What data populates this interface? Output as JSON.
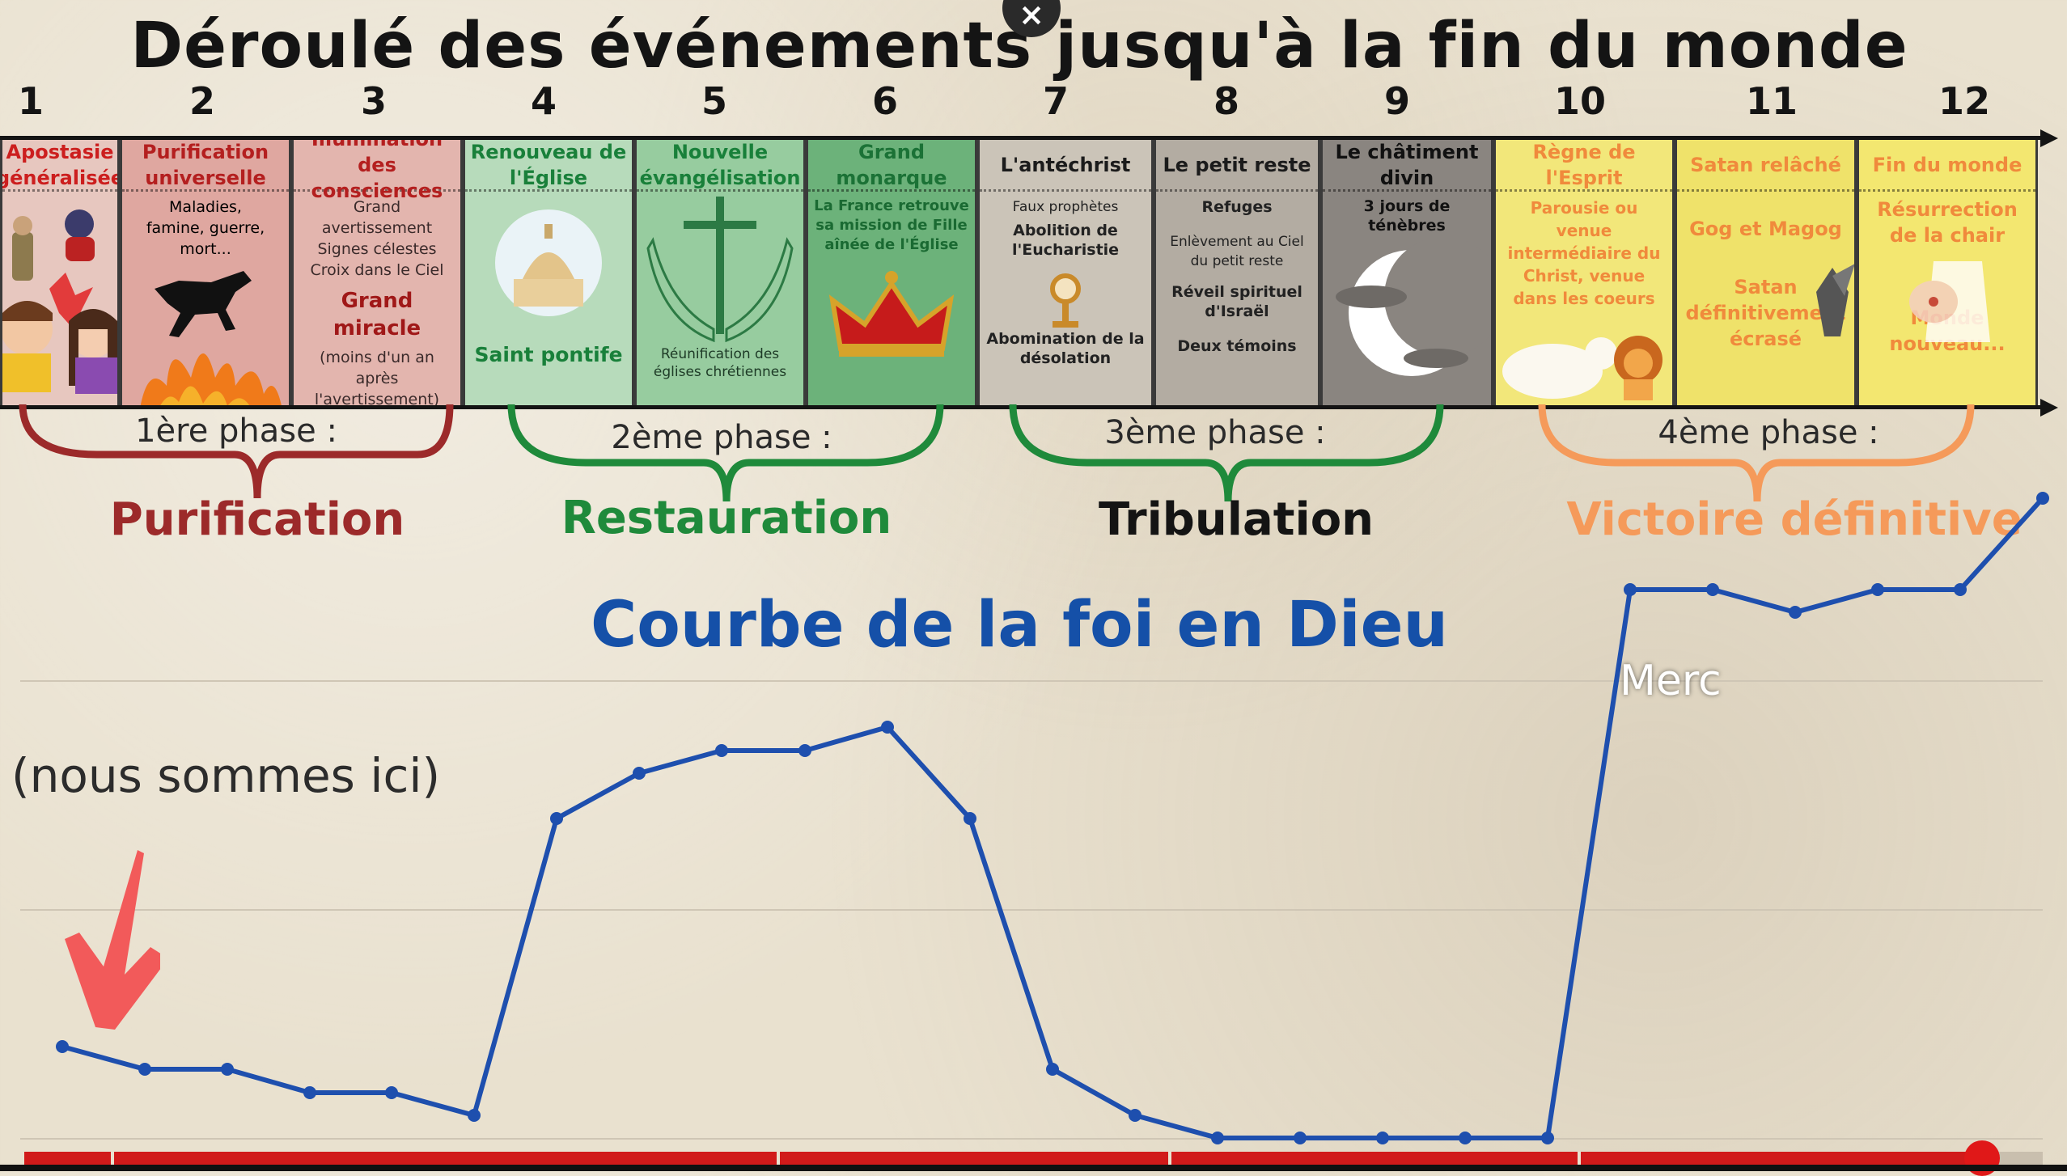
{
  "title": "Déroulé des événements jusqu'à la fin du monde",
  "close_icon": "×",
  "numbers": [
    "1",
    "2",
    "3",
    "4",
    "5",
    "6",
    "7",
    "8",
    "9",
    "10",
    "11",
    "12"
  ],
  "panels": [
    {
      "title": "Apostasie généralisée",
      "lines": [],
      "color": "#cc1e1e",
      "bg": "#e7c7bf"
    },
    {
      "title": "Purification universelle",
      "lines": [
        "Maladies,",
        "famine, guerre, mort..."
      ],
      "color": "#b41f1f",
      "bg": "#dfa7a0"
    },
    {
      "title": "Illumination des consciences",
      "lines": [
        "Grand avertissement",
        "Signes célestes",
        "Croix dans le Ciel"
      ],
      "big": "Grand miracle",
      "tail": [
        "(moins d'un an après",
        "l'avertissement)"
      ],
      "color": "#b41f1f",
      "bg": "#e3b5ae"
    },
    {
      "title": "Renouveau de l'Église",
      "foot": "Saint pontife",
      "color": "#19803a",
      "bg": "#b7dbbb"
    },
    {
      "title": "Nouvelle évangélisation",
      "foot": "Réunification des églises chrétiennes",
      "color": "#19803a",
      "bg": "#97cc9f"
    },
    {
      "title": "Grand monarque",
      "lines": [
        "La France retrouve sa mission de Fille aînée de l'Église"
      ],
      "color": "#1b7236",
      "bg": "#6cb27a"
    },
    {
      "title": "L'antéchrist",
      "lines": [
        "Faux prophètes"
      ],
      "bold": [
        "Abolition de l'Eucharistie"
      ],
      "foot": "Abomination de la désolation",
      "color": "#1b1b1b",
      "bg": "#cbc4b8"
    },
    {
      "title": "Le petit reste",
      "bold": [
        "Refuges"
      ],
      "lines": [
        "Enlèvement au Ciel du petit reste"
      ],
      "bold2": [
        "Réveil spirituel d'Israël",
        "Deux témoins"
      ],
      "color": "#1b1b1b",
      "bg": "#b3aca2"
    },
    {
      "title": "Le châtiment divin",
      "bold": [
        "3 jours de ténèbres"
      ],
      "color": "#111111",
      "bg": "#8a8580"
    },
    {
      "title": "Règne de l'Esprit",
      "lines": [
        "Parousie ou venue intermédiaire du Christ, venue dans les coeurs"
      ],
      "color": "#f08a3c",
      "bg": "#f2e77a"
    },
    {
      "title": "Satan relâché",
      "lines": [
        "Gog et Magog",
        "Satan définitivement écrasé"
      ],
      "color": "#f08a3c",
      "bg": "#efe26a"
    },
    {
      "title": "Fin du monde",
      "lines": [
        "Résurrection de la chair",
        "Monde nouveau..."
      ],
      "color": "#f08a3c",
      "bg": "#f3e770"
    }
  ],
  "phases": [
    {
      "label": "1ère phase :",
      "name": "Purification",
      "color": "#9c2a2a"
    },
    {
      "label": "2ème phase :",
      "name": "Restauration",
      "color": "#1f8a3b"
    },
    {
      "label": "3ème phase :",
      "name": "Tribulation",
      "color": "#141414"
    },
    {
      "label": "4ème phase :",
      "name": "Victoire définitive",
      "color": "#f08a4a"
    }
  ],
  "curve_title": "Courbe de la foi en Dieu",
  "here_label": "(nous sommes ici)",
  "overlay_text": "Merc",
  "video_progress": 0.97,
  "colors": {
    "curve": "#1e4fae",
    "arrow": "#f25a5a",
    "progress": "#d11a1a"
  }
}
